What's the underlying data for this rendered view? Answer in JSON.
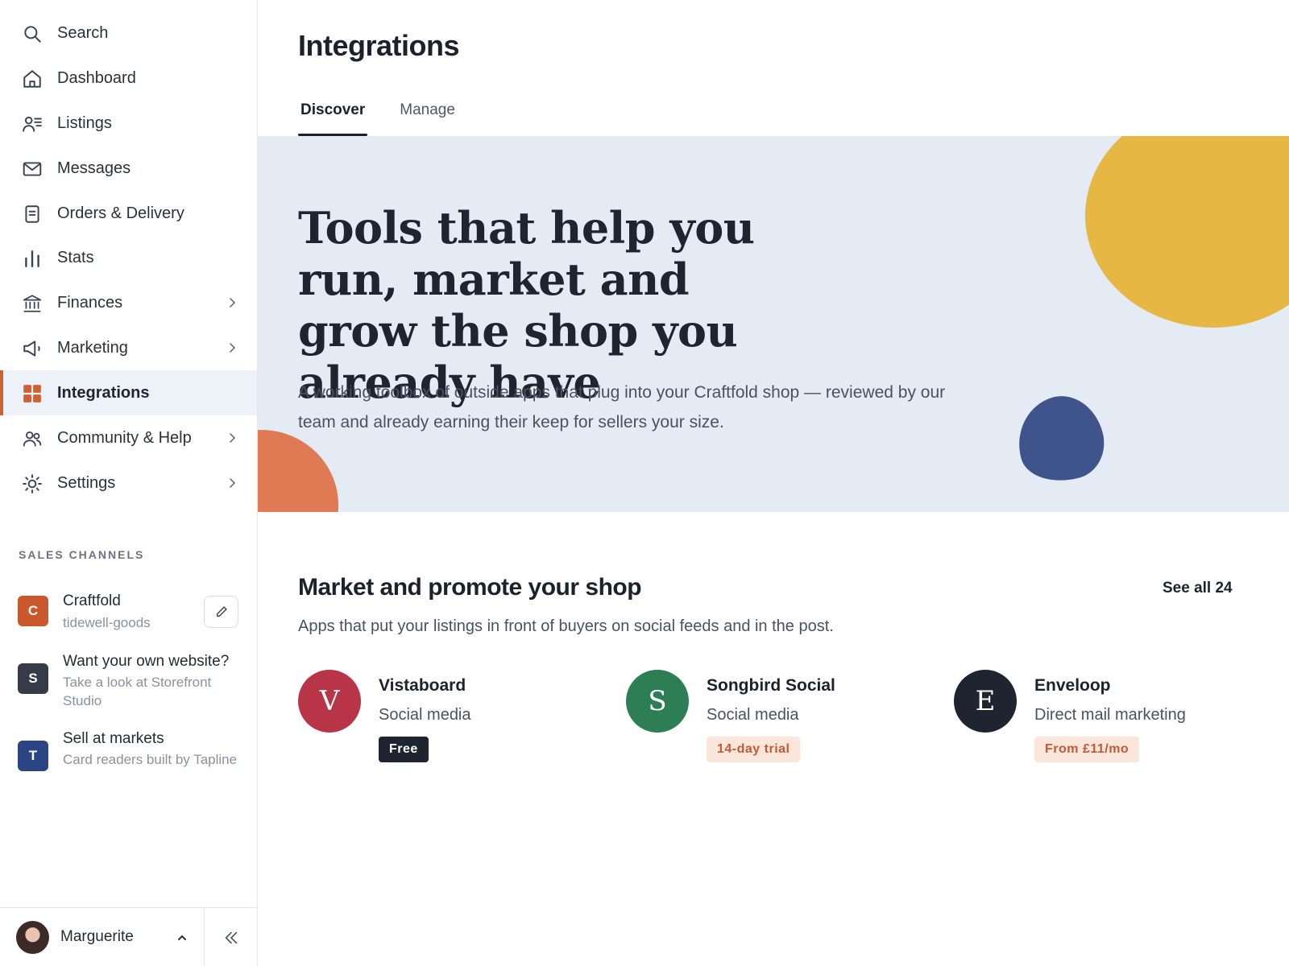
{
  "sidebar": {
    "nav": [
      {
        "label": "Search",
        "icon": "search-icon"
      },
      {
        "label": "Dashboard",
        "icon": "home-icon"
      },
      {
        "label": "Listings",
        "icon": "listings-icon"
      },
      {
        "label": "Messages",
        "icon": "mail-icon"
      },
      {
        "label": "Orders & Delivery",
        "icon": "clipboard-icon"
      },
      {
        "label": "Stats",
        "icon": "bar-chart-icon"
      },
      {
        "label": "Finances",
        "icon": "bank-icon"
      },
      {
        "label": "Marketing",
        "icon": "megaphone-icon"
      },
      {
        "label": "Integrations",
        "icon": "grid-icon"
      },
      {
        "label": "Community & Help",
        "icon": "people-icon"
      },
      {
        "label": "Settings",
        "icon": "gear-icon"
      }
    ],
    "active_item": "Integrations",
    "sales_channels_heading": "SALES CHANNELS",
    "channels": [
      {
        "badge": "C",
        "title": "Craftfold",
        "subtitle": "tidewell-goods",
        "color": "#c9582c"
      },
      {
        "badge": "S",
        "title": "Want your own website?",
        "subtitle": "Take a look at Storefront Studio",
        "color": "#353c48"
      },
      {
        "badge": "T",
        "title": "Sell at markets",
        "subtitle": "Card readers built by Tapline",
        "color": "#2b4584"
      }
    ],
    "user": {
      "name": "Marguerite"
    }
  },
  "main": {
    "title": "Integrations",
    "tabs": [
      {
        "label": "Discover",
        "active": true
      },
      {
        "label": "Manage",
        "active": false
      }
    ],
    "hero": {
      "headline": "Tools that help you run, market and grow the shop you already have",
      "description": "A working toolbox of outside apps that plug into your Craftfold shop — reviewed by our team and already earning their keep for sellers your size."
    },
    "section": {
      "title": "Market and promote your shop",
      "see_all": "See all 24",
      "description": "Apps that put your listings in front of buyers on social feeds and in the post.",
      "apps": [
        {
          "initial": "V",
          "name": "Vistaboard",
          "category": "Social media",
          "badge": "Free",
          "logo_color": "#b83548",
          "badge_style": "dark"
        },
        {
          "initial": "S",
          "name": "Songbird Social",
          "category": "Social media",
          "badge": "14-day trial",
          "logo_color": "#2d7d55",
          "badge_style": "peach"
        },
        {
          "initial": "E",
          "name": "Enveloop",
          "category": "Direct mail marketing",
          "badge": "From £11/mo",
          "logo_color": "#1e2430",
          "badge_style": "peach"
        }
      ]
    }
  },
  "colors": {
    "accent": "#d25f2f",
    "hero_bg": "#e4ebf5",
    "blob_yellow": "#e6b843",
    "blob_blue": "#3e548b",
    "blob_orange": "#df7a54"
  }
}
